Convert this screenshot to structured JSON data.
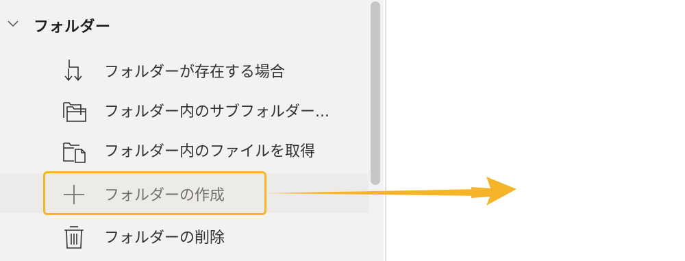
{
  "group": {
    "title": "フォルダー",
    "expanded_icon": "chevron-down-icon"
  },
  "items": [
    {
      "label": "フォルダーが存在する場合",
      "icon": "folder-exists-icon"
    },
    {
      "label": "フォルダー内のサブフォルダー...",
      "icon": "subfolders-icon"
    },
    {
      "label": "フォルダー内のファイルを取得",
      "icon": "folder-files-icon"
    },
    {
      "label": "フォルダーの作成",
      "icon": "plus-icon",
      "selected": true
    },
    {
      "label": "フォルダーの削除",
      "icon": "trash-icon"
    }
  ],
  "colors": {
    "panel_bg": "#f3f2f1",
    "highlight": "#f6b42b",
    "arrow": "#f6b42b",
    "text": "#323130"
  }
}
